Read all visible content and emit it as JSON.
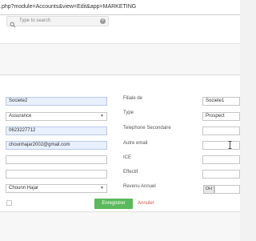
{
  "browser": {
    "url": ".php?module=Accounts&view=Edit&app=MARKETING"
  },
  "search": {
    "placeholder": "Type to search"
  },
  "left_fields": {
    "name": "Societe2",
    "industry": "Assurance",
    "phone": "0623227712",
    "email": "chounhajar2002@gmail.com",
    "blank1": "",
    "blank2": "",
    "assigned_to": "Chounn Hajar"
  },
  "right_labels": {
    "parent": "Filiale de",
    "type": "Type",
    "secondary_phone": "Telephone Secondaire",
    "other_email": "Autre email",
    "ice": "ICE",
    "employees": "Effectif",
    "annual_revenue": "Revenu Annuel"
  },
  "right_fields": {
    "parent": "Societe1",
    "type": "Prospect",
    "secondary_phone": "",
    "other_email": "",
    "ice": "",
    "employees": "",
    "currency": "DH"
  },
  "actions": {
    "save": "Enregistrer",
    "cancel": "Annuler"
  },
  "colors": {
    "save": "#5cb85c",
    "cancel": "#d9534f",
    "autofill": "#e8f0fe"
  }
}
